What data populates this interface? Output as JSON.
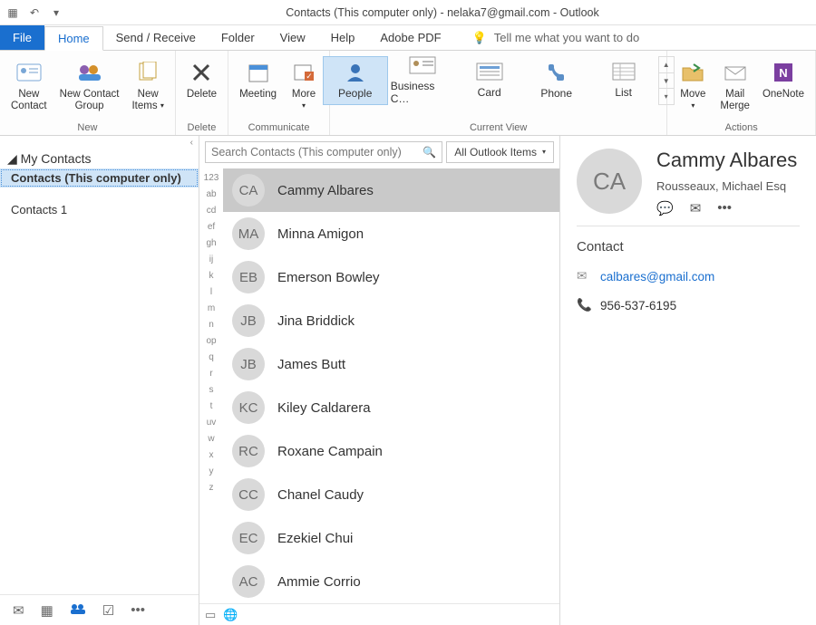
{
  "title": "Contacts (This computer only) - nelaka7@gmail.com  -  Outlook",
  "menu_tabs": {
    "file": "File",
    "home": "Home",
    "send_receive": "Send / Receive",
    "folder": "Folder",
    "view": "View",
    "help": "Help",
    "adobe_pdf": "Adobe PDF"
  },
  "tell_me": "Tell me what you want to do",
  "ribbon": {
    "new_contact": "New\nContact",
    "new_contact_group": "New Contact\nGroup",
    "new_items": "New\nItems",
    "delete": "Delete",
    "meeting": "Meeting",
    "more": "More",
    "people": "People",
    "business_card": "Business C…",
    "card": "Card",
    "phone": "Phone",
    "list": "List",
    "move": "Move",
    "mail_merge": "Mail\nMerge",
    "onenote": "OneNote",
    "group_new": "New",
    "group_delete": "Delete",
    "group_communicate": "Communicate",
    "group_current_view": "Current View",
    "group_actions": "Actions"
  },
  "nav": {
    "header": "My Contacts",
    "items": [
      "Contacts (This computer only)",
      "Contacts 1"
    ]
  },
  "search": {
    "placeholder": "Search Contacts (This computer only)",
    "scope": "All Outlook Items"
  },
  "alpha_index": [
    "123",
    "ab",
    "cd",
    "ef",
    "gh",
    "ij",
    "k",
    "l",
    "m",
    "n",
    "op",
    "q",
    "r",
    "s",
    "t",
    "uv",
    "w",
    "x",
    "y",
    "z"
  ],
  "contacts": [
    {
      "initials": "CA",
      "name": "Cammy Albares",
      "selected": true
    },
    {
      "initials": "MA",
      "name": "Minna Amigon"
    },
    {
      "initials": "EB",
      "name": "Emerson Bowley"
    },
    {
      "initials": "JB",
      "name": "Jina Briddick"
    },
    {
      "initials": "JB",
      "name": "James Butt"
    },
    {
      "initials": "KC",
      "name": "Kiley Caldarera"
    },
    {
      "initials": "RC",
      "name": "Roxane Campain"
    },
    {
      "initials": "CC",
      "name": "Chanel Caudy"
    },
    {
      "initials": "EC",
      "name": "Ezekiel Chui"
    },
    {
      "initials": "AC",
      "name": "Ammie Corrio"
    }
  ],
  "card": {
    "initials": "CA",
    "name": "Cammy Albares",
    "company": "Rousseaux, Michael Esq",
    "section_contact": "Contact",
    "email": "calbares@gmail.com",
    "phone": "956-537-6195"
  }
}
